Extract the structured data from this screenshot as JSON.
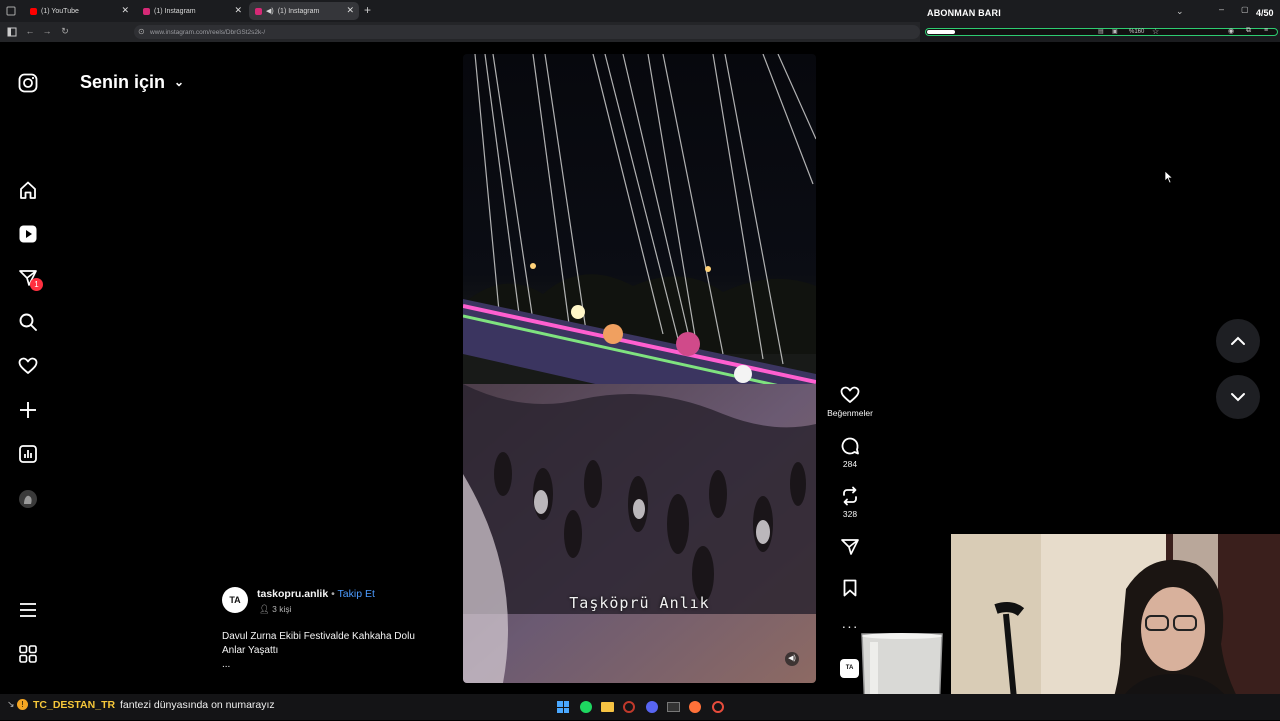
{
  "browser": {
    "tabs": [
      {
        "title": "(1) YouTube",
        "favicon_color": "#ff0000"
      },
      {
        "title": "(1) Instagram",
        "favicon_color": "#d62976"
      },
      {
        "title": "(1) Instagram",
        "favicon_color": "#d62976",
        "active": true
      }
    ],
    "new_tab_label": "+",
    "url": "www.instagram.com/reels/DbrGSt2s2k-/"
  },
  "overlay": {
    "title": "ABONMAN BARI",
    "count": "4/50",
    "progress": 0.08,
    "zoom": "%160",
    "accent": "#2ecc71"
  },
  "instagram": {
    "feed_title": "Senin için",
    "sidebar": [
      {
        "name": "instagram-logo-icon"
      },
      {
        "name": "home-icon"
      },
      {
        "name": "reels-icon"
      },
      {
        "name": "messages-icon",
        "badge": "1"
      },
      {
        "name": "search-icon"
      },
      {
        "name": "notifications-icon"
      },
      {
        "name": "create-icon"
      },
      {
        "name": "dashboard-icon"
      },
      {
        "name": "profile-avatar"
      },
      {
        "name": "menu-icon"
      },
      {
        "name": "more-apps-icon"
      }
    ],
    "post": {
      "username": "taskopru.anlik",
      "separator": "•",
      "follow_label": "Takip Et",
      "collab": "3 kişi",
      "caption_line1": "Davul Zurna Ekibi Festivalde Kahkaha Dolu",
      "caption_line2": "Anlar Yaşattı",
      "more": "...",
      "watermark": "Taşköprü Anlık",
      "avatar_text": "TA"
    },
    "actions": {
      "like_label": "Beğenmeler",
      "comments": "284",
      "reposts": "328"
    }
  },
  "chat": {
    "user": "TC_DESTAN_TR",
    "message": "fantezi dünyasında on numarayız"
  }
}
